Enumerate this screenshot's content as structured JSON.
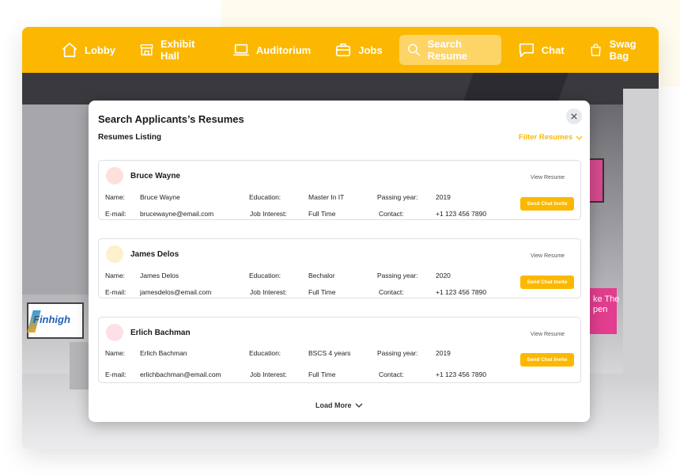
{
  "nav": {
    "items": [
      {
        "label": "Lobby",
        "icon": "home-icon"
      },
      {
        "label": "Exhibit Hall",
        "icon": "storefront-icon"
      },
      {
        "label": "Auditorium",
        "icon": "laptop-icon"
      },
      {
        "label": "Jobs",
        "icon": "briefcase-icon"
      },
      {
        "label": "Search Resume",
        "icon": "search-icon",
        "active": true
      },
      {
        "label": "Chat",
        "icon": "chat-icon"
      },
      {
        "label": "Swag Bag",
        "icon": "shopping-bag-icon"
      }
    ]
  },
  "scene": {
    "tv_logo": "Finhigh",
    "pink_screen_text": "ke The\npen"
  },
  "modal": {
    "title": "Search Applicants’s Resumes",
    "subtitle": "Resumes Listing",
    "filter_label": "Filter Resumes",
    "load_more_label": "Load More"
  },
  "labels": {
    "name": "Name:",
    "education": "Education:",
    "passing_year": "Passing year:",
    "email": "E-mail:",
    "job_interest": "Job Interest:",
    "contact": "Contact:",
    "view_resume": "View Resume",
    "send_chat_invite": "Send Chat Invite"
  },
  "candidates": [
    {
      "name": "Bruce Wayne",
      "education": "Master In IT",
      "passing_year": "2019",
      "email": "brucewayne@email.com",
      "job_interest": "Full Time",
      "contact": "+1 123 456 7890",
      "avatar_color": "#fde0dc"
    },
    {
      "name": "James Delos",
      "education": "Bechalor",
      "passing_year": "2020",
      "email": "jamesdelos@email.com",
      "job_interest": "Full Time",
      "contact": "+1 123 456 7890",
      "avatar_color": "#fdf0cc"
    },
    {
      "name": "Erlich Bachman",
      "education": "BSCS 4 years",
      "passing_year": "2019",
      "email": "erlichbachman@email.com",
      "job_interest": "Full Time",
      "contact": "+1 123 456 7890",
      "avatar_color": "#fde0e6"
    }
  ],
  "colors": {
    "accent": "#fcb800",
    "accent_light": "#fdd466"
  }
}
